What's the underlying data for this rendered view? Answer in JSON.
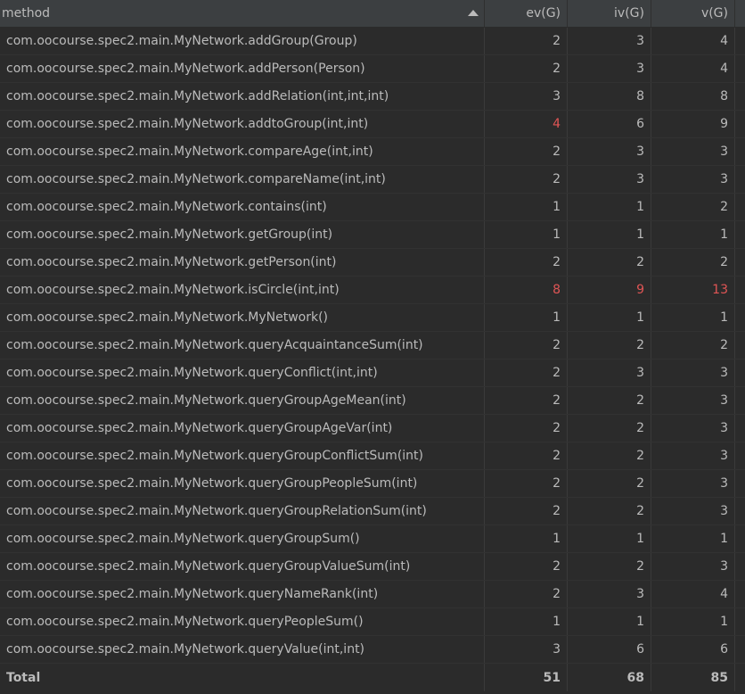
{
  "columns": {
    "method": "method",
    "ev": "ev(G)",
    "iv": "iv(G)",
    "v": "v(G)"
  },
  "rows": [
    {
      "method": "com.oocourse.spec2.main.MyNetwork.addGroup(Group)",
      "ev": "2",
      "iv": "3",
      "v": "4",
      "hl": [
        false,
        false,
        false
      ]
    },
    {
      "method": "com.oocourse.spec2.main.MyNetwork.addPerson(Person)",
      "ev": "2",
      "iv": "3",
      "v": "4",
      "hl": [
        false,
        false,
        false
      ]
    },
    {
      "method": "com.oocourse.spec2.main.MyNetwork.addRelation(int,int,int)",
      "ev": "3",
      "iv": "8",
      "v": "8",
      "hl": [
        false,
        false,
        false
      ]
    },
    {
      "method": "com.oocourse.spec2.main.MyNetwork.addtoGroup(int,int)",
      "ev": "4",
      "iv": "6",
      "v": "9",
      "hl": [
        true,
        false,
        false
      ]
    },
    {
      "method": "com.oocourse.spec2.main.MyNetwork.compareAge(int,int)",
      "ev": "2",
      "iv": "3",
      "v": "3",
      "hl": [
        false,
        false,
        false
      ]
    },
    {
      "method": "com.oocourse.spec2.main.MyNetwork.compareName(int,int)",
      "ev": "2",
      "iv": "3",
      "v": "3",
      "hl": [
        false,
        false,
        false
      ]
    },
    {
      "method": "com.oocourse.spec2.main.MyNetwork.contains(int)",
      "ev": "1",
      "iv": "1",
      "v": "2",
      "hl": [
        false,
        false,
        false
      ]
    },
    {
      "method": "com.oocourse.spec2.main.MyNetwork.getGroup(int)",
      "ev": "1",
      "iv": "1",
      "v": "1",
      "hl": [
        false,
        false,
        false
      ]
    },
    {
      "method": "com.oocourse.spec2.main.MyNetwork.getPerson(int)",
      "ev": "2",
      "iv": "2",
      "v": "2",
      "hl": [
        false,
        false,
        false
      ]
    },
    {
      "method": "com.oocourse.spec2.main.MyNetwork.isCircle(int,int)",
      "ev": "8",
      "iv": "9",
      "v": "13",
      "hl": [
        true,
        true,
        true
      ]
    },
    {
      "method": "com.oocourse.spec2.main.MyNetwork.MyNetwork()",
      "ev": "1",
      "iv": "1",
      "v": "1",
      "hl": [
        false,
        false,
        false
      ]
    },
    {
      "method": "com.oocourse.spec2.main.MyNetwork.queryAcquaintanceSum(int)",
      "ev": "2",
      "iv": "2",
      "v": "2",
      "hl": [
        false,
        false,
        false
      ]
    },
    {
      "method": "com.oocourse.spec2.main.MyNetwork.queryConflict(int,int)",
      "ev": "2",
      "iv": "3",
      "v": "3",
      "hl": [
        false,
        false,
        false
      ]
    },
    {
      "method": "com.oocourse.spec2.main.MyNetwork.queryGroupAgeMean(int)",
      "ev": "2",
      "iv": "2",
      "v": "3",
      "hl": [
        false,
        false,
        false
      ]
    },
    {
      "method": "com.oocourse.spec2.main.MyNetwork.queryGroupAgeVar(int)",
      "ev": "2",
      "iv": "2",
      "v": "3",
      "hl": [
        false,
        false,
        false
      ]
    },
    {
      "method": "com.oocourse.spec2.main.MyNetwork.queryGroupConflictSum(int)",
      "ev": "2",
      "iv": "2",
      "v": "3",
      "hl": [
        false,
        false,
        false
      ]
    },
    {
      "method": "com.oocourse.spec2.main.MyNetwork.queryGroupPeopleSum(int)",
      "ev": "2",
      "iv": "2",
      "v": "3",
      "hl": [
        false,
        false,
        false
      ]
    },
    {
      "method": "com.oocourse.spec2.main.MyNetwork.queryGroupRelationSum(int)",
      "ev": "2",
      "iv": "2",
      "v": "3",
      "hl": [
        false,
        false,
        false
      ]
    },
    {
      "method": "com.oocourse.spec2.main.MyNetwork.queryGroupSum()",
      "ev": "1",
      "iv": "1",
      "v": "1",
      "hl": [
        false,
        false,
        false
      ]
    },
    {
      "method": "com.oocourse.spec2.main.MyNetwork.queryGroupValueSum(int)",
      "ev": "2",
      "iv": "2",
      "v": "3",
      "hl": [
        false,
        false,
        false
      ]
    },
    {
      "method": "com.oocourse.spec2.main.MyNetwork.queryNameRank(int)",
      "ev": "2",
      "iv": "3",
      "v": "4",
      "hl": [
        false,
        false,
        false
      ]
    },
    {
      "method": "com.oocourse.spec2.main.MyNetwork.queryPeopleSum()",
      "ev": "1",
      "iv": "1",
      "v": "1",
      "hl": [
        false,
        false,
        false
      ]
    },
    {
      "method": "com.oocourse.spec2.main.MyNetwork.queryValue(int,int)",
      "ev": "3",
      "iv": "6",
      "v": "6",
      "hl": [
        false,
        false,
        false
      ]
    }
  ],
  "total": {
    "label": "Total",
    "ev": "51",
    "iv": "68",
    "v": "85"
  },
  "colors": {
    "highlight": "#e05555",
    "background": "#2b2b2b",
    "header": "#3c3f41",
    "text": "#bbbbbb"
  },
  "icons": {
    "sort": "sort-ascending-icon"
  }
}
